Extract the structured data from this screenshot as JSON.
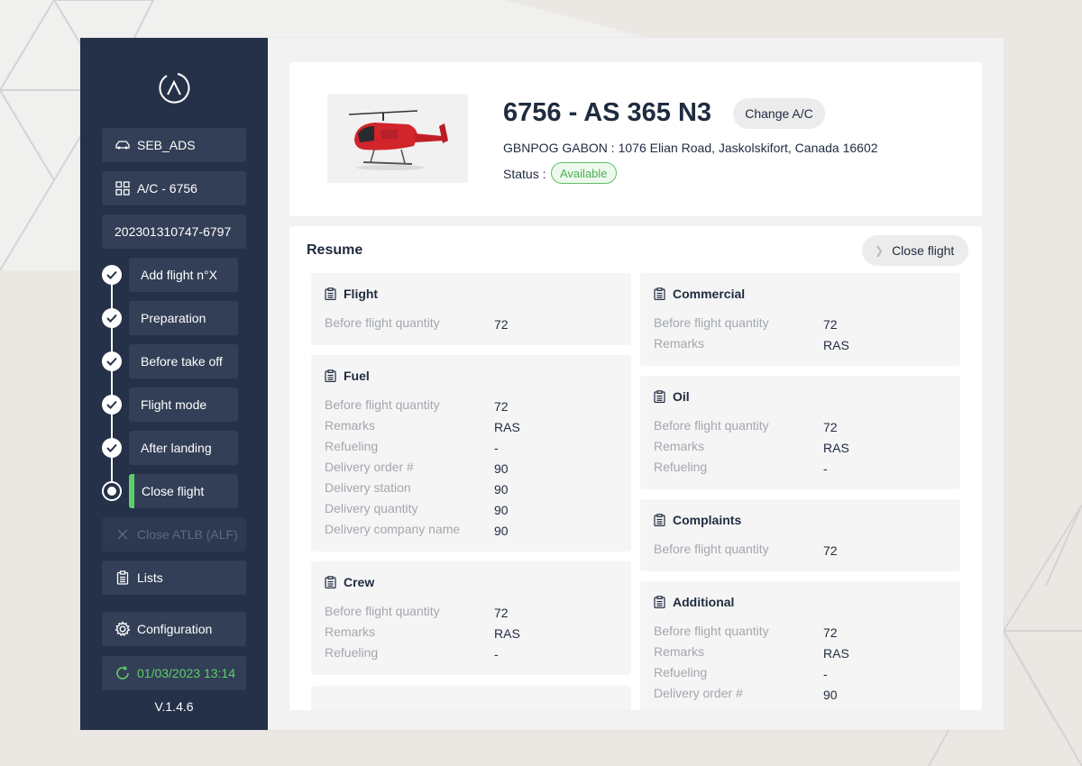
{
  "sidebar": {
    "user_label": "SEB_ADS",
    "aircraft_label": "A/C - 6756",
    "flight_id": "202301310747-6797",
    "steps": [
      {
        "label": "Add flight n°X",
        "state": "done"
      },
      {
        "label": "Preparation",
        "state": "done"
      },
      {
        "label": "Before take off",
        "state": "done"
      },
      {
        "label": "Flight mode",
        "state": "done"
      },
      {
        "label": "After landing",
        "state": "done"
      },
      {
        "label": "Close flight",
        "state": "current"
      }
    ],
    "close_atlb_label": "Close ATLB (ALF)",
    "lists_label": "Lists",
    "configuration_label": "Configuration",
    "sync_datetime": "01/03/2023 13:14",
    "version": "V.1.4.6"
  },
  "aircraft": {
    "title": "6756 - AS 365 N3",
    "change_label": "Change A/C",
    "address": "GBNPOG GABON : 1076 Elian Road, Jaskolskifort, Canada 16602",
    "status_label": "Status :",
    "status_value": "Available"
  },
  "resume": {
    "title": "Resume",
    "close_flight_label": "Close flight",
    "cards": {
      "flight": {
        "title": "Flight",
        "rows": [
          {
            "label": "Before flight quantity",
            "value": "72"
          }
        ]
      },
      "fuel": {
        "title": "Fuel",
        "rows": [
          {
            "label": "Before flight quantity",
            "value": "72"
          },
          {
            "label": "Remarks",
            "value": "RAS"
          },
          {
            "label": "Refueling",
            "value": "-"
          },
          {
            "label": "Delivery order #",
            "value": "90"
          },
          {
            "label": "Delivery station",
            "value": "90"
          },
          {
            "label": "Delivery quantity",
            "value": "90"
          },
          {
            "label": "Delivery company name",
            "value": "90"
          }
        ]
      },
      "crew": {
        "title": "Crew",
        "rows": [
          {
            "label": "Before flight quantity",
            "value": "72"
          },
          {
            "label": "Remarks",
            "value": "RAS"
          },
          {
            "label": "Refueling",
            "value": "-"
          }
        ]
      },
      "commercial": {
        "title": "Commercial",
        "rows": [
          {
            "label": "Before flight quantity",
            "value": "72"
          },
          {
            "label": "Remarks",
            "value": "RAS"
          }
        ]
      },
      "oil": {
        "title": "Oil",
        "rows": [
          {
            "label": "Before flight quantity",
            "value": "72"
          },
          {
            "label": "Remarks",
            "value": "RAS"
          },
          {
            "label": "Refueling",
            "value": "-"
          }
        ]
      },
      "complaints": {
        "title": "Complaints",
        "rows": [
          {
            "label": "Before flight quantity",
            "value": "72"
          }
        ]
      },
      "additional": {
        "title": "Additional",
        "rows": [
          {
            "label": "Before flight quantity",
            "value": "72"
          },
          {
            "label": "Remarks",
            "value": "RAS"
          },
          {
            "label": "Refueling",
            "value": "-"
          },
          {
            "label": "Delivery order #",
            "value": "90"
          }
        ]
      }
    }
  },
  "colors": {
    "sidebar_bg": "#243148",
    "accent_green": "#5fce6a",
    "status_green": "#4cae51"
  }
}
